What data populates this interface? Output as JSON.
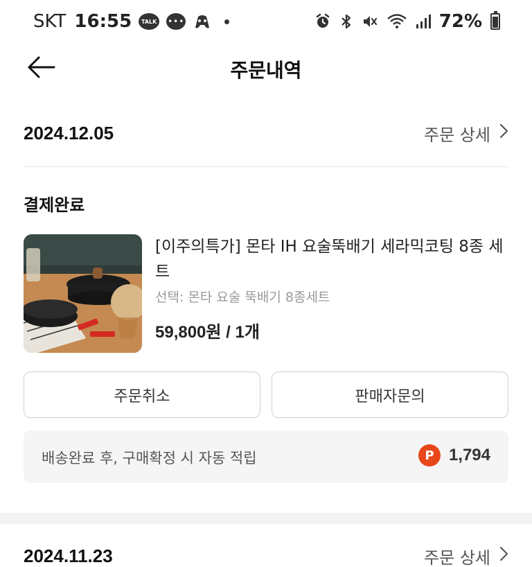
{
  "status_bar": {
    "carrier": "SKT",
    "time": "16:55",
    "talk_label": "TALK",
    "battery": "72%"
  },
  "header": {
    "title": "주문내역"
  },
  "orders": [
    {
      "date": "2024.12.05",
      "detail_label": "주문 상세",
      "status": "결제완료",
      "product": {
        "name": "[이주의특가] 몬타 IH 요술뚝배기 세라믹코팅 8종 세트",
        "option": "선택: 몬타 요술 뚝배기 8종세트",
        "price": "59,800원 / 1개"
      },
      "buttons": {
        "cancel": "주문취소",
        "inquiry": "판매자문의"
      },
      "point": {
        "text": "배송완료 후, 구매확정 시 자동 적립",
        "badge": "P",
        "value": "1,794"
      }
    },
    {
      "date": "2024.11.23",
      "detail_label": "주문 상세"
    }
  ],
  "colors": {
    "point_badge": "#e8461b",
    "divider": "#e6e6e6",
    "point_bg": "#f5f5f5"
  },
  "icons": [
    "talk-icon",
    "chat-icon",
    "game-icon",
    "alarm-icon",
    "bluetooth-icon",
    "mute-icon",
    "wifi-icon",
    "signal-icon",
    "battery-icon",
    "back-arrow-icon",
    "chevron-right-icon",
    "point-badge-icon"
  ]
}
